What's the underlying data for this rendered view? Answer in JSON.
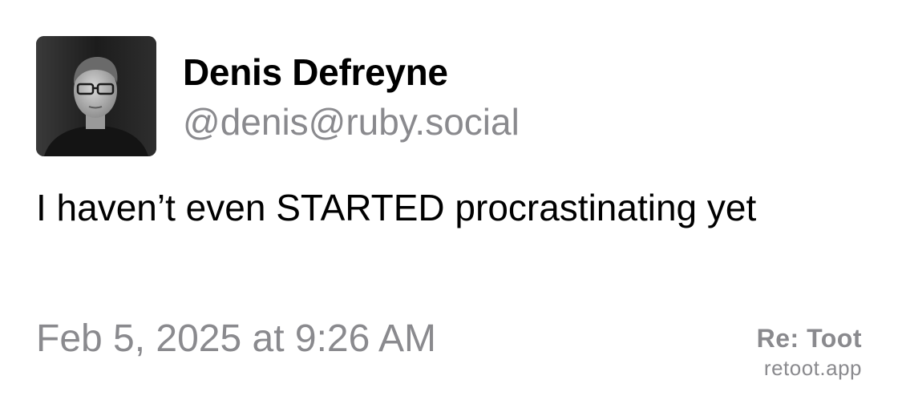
{
  "author": {
    "display_name": "Denis Defreyne",
    "handle": "@denis@ruby.social"
  },
  "post": {
    "text": "I haven’t even STARTED procrastinating yet",
    "timestamp": "Feb 5, 2025 at 9:26 AM"
  },
  "branding": {
    "name": "Re: Toot",
    "url": "retoot.app"
  },
  "colors": {
    "text": "#000000",
    "secondary": "#8a8a8e",
    "background": "#ffffff"
  }
}
